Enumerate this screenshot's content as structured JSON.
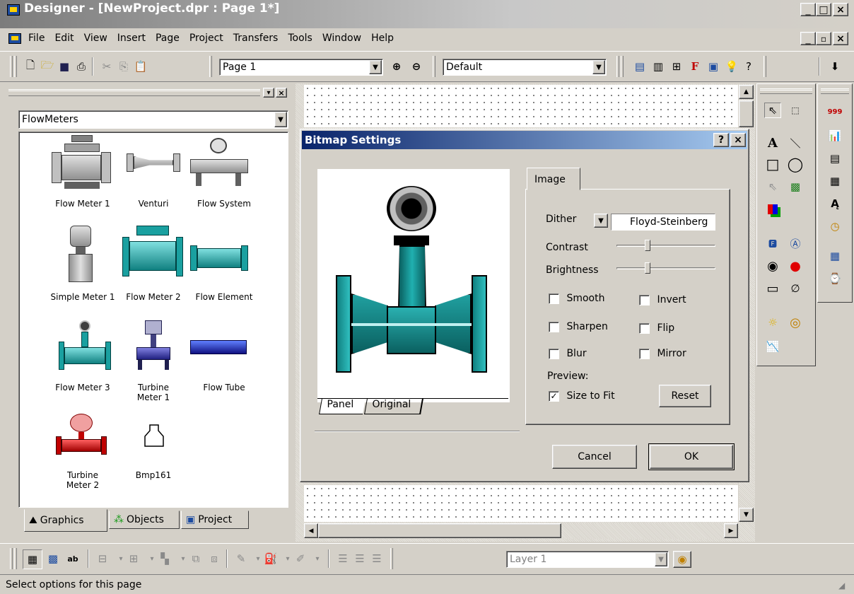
{
  "window": {
    "title": "Designer - [NewProject.dpr : Page 1*]",
    "min": "_",
    "max": "□",
    "close": "×",
    "restore": "▫"
  },
  "menu": [
    "File",
    "Edit",
    "View",
    "Insert",
    "Page",
    "Project",
    "Transfers",
    "Tools",
    "Window",
    "Help"
  ],
  "toolbar": {
    "page_combo": "Page 1",
    "style_combo": "Default"
  },
  "library": {
    "category": "FlowMeters",
    "items": [
      {
        "label": "Flow Meter 1"
      },
      {
        "label": "Venturi"
      },
      {
        "label": "Flow System"
      },
      {
        "label": "Simple Meter 1"
      },
      {
        "label": "Flow Meter 2"
      },
      {
        "label": "Flow Element"
      },
      {
        "label": "Flow Meter 3"
      },
      {
        "label": "Turbine Meter 1"
      },
      {
        "label": "Flow Tube"
      },
      {
        "label": "Turbine Meter 2"
      },
      {
        "label": "Bmp161"
      }
    ],
    "tabs": [
      "Graphics",
      "Objects",
      "Project"
    ]
  },
  "dialog": {
    "title": "Bitmap Settings",
    "help": "?",
    "close": "×",
    "preview_tabs": [
      "Panel",
      "Original"
    ],
    "image_tab": "Image",
    "dither_label": "Dither",
    "dither_value": "Floyd-Steinberg",
    "contrast_label": "Contrast",
    "contrast_level": 0.3,
    "brightness_label": "Brightness",
    "brightness_level": 0.3,
    "smooth": "Smooth",
    "invert": "Invert",
    "sharpen": "Sharpen",
    "flip": "Flip",
    "blur": "Blur",
    "mirror": "Mirror",
    "preview_label": "Preview:",
    "size_to_fit": "Size to Fit",
    "size_to_fit_checked": "✓",
    "reset": "Reset",
    "cancel": "Cancel",
    "ok": "OK"
  },
  "bottom_toolbar": {
    "layer_combo": "Layer 1"
  },
  "status": {
    "text": "Select options for this page"
  }
}
